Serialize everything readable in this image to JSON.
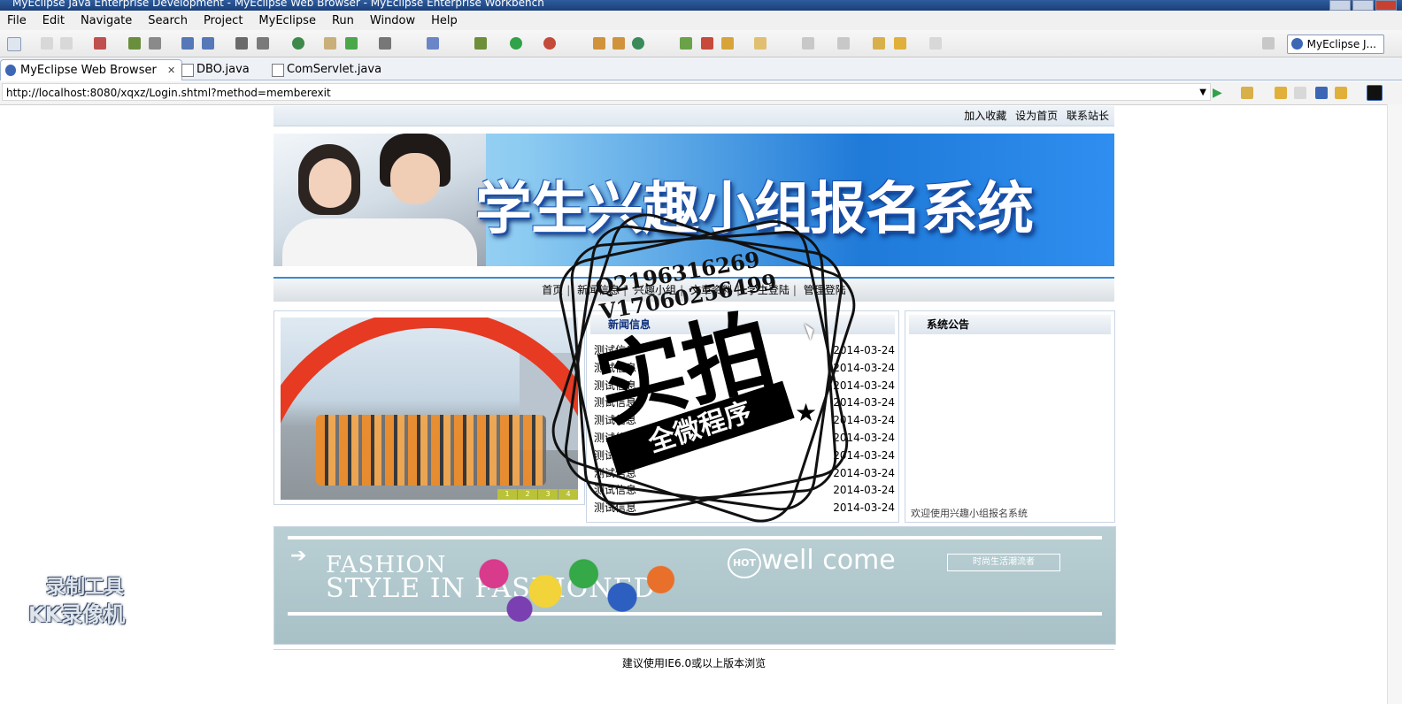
{
  "window": {
    "title": "MyEclipse Java Enterprise Development - MyEclipse Web Browser - MyEclipse Enterprise Workbench"
  },
  "menu": [
    "File",
    "Edit",
    "Navigate",
    "Search",
    "Project",
    "MyEclipse",
    "Run",
    "Window",
    "Help"
  ],
  "toolbar": {
    "perspective_label": "MyEclipse J..."
  },
  "tabs": [
    {
      "label": "MyEclipse Web Browser",
      "close": "✕"
    },
    {
      "label": "DBO.java"
    },
    {
      "label": "ComServlet.java"
    }
  ],
  "address": {
    "url": "http://localhost:8080/xqxz/Login.shtml?method=memberexit"
  },
  "site": {
    "top_links": [
      "加入收藏",
      "设为首页",
      "联系站长"
    ],
    "banner_title": "学生兴趣小组报名系统",
    "nav": [
      "首页",
      "新闻信息",
      "兴趣小组",
      "文章资料",
      "学生登陆",
      "管理登陆"
    ],
    "photo_pager": [
      "1",
      "2",
      "3",
      "4"
    ],
    "news": {
      "title": "新闻信息",
      "items": [
        {
          "title": "测试信息",
          "date": "2014-03-24"
        },
        {
          "title": "测试信息",
          "date": "2014-03-24"
        },
        {
          "title": "测试信息",
          "date": "2014-03-24"
        },
        {
          "title": "测试信息",
          "date": "2014-03-24"
        },
        {
          "title": "测试信息",
          "date": "2014-03-24"
        },
        {
          "title": "测试信息",
          "date": "2014-03-24"
        },
        {
          "title": "测试信息",
          "date": "2014-03-24"
        },
        {
          "title": "测试信息",
          "date": "2014-03-24"
        },
        {
          "title": "测试信息",
          "date": "2014-03-24"
        },
        {
          "title": "测试信息",
          "date": "2014-03-24"
        }
      ]
    },
    "notice": {
      "title": "系统公告",
      "scroll_text": "欢迎使用兴趣小组报名系统"
    },
    "fashion": {
      "line1": "FASHION",
      "line2": "STYLE IN FASHIONED",
      "hot": "HOT",
      "welcome": "well come",
      "button": "时尚生活潮流者"
    },
    "footer": "建议使用IE6.0或以上版本浏览"
  },
  "overlay": {
    "qq": "Q2196316269",
    "vx": "V17060256499",
    "stamp_big": "实拍",
    "stamp_ribbon": "全微程序",
    "recorder_line1": "录制工具",
    "recorder_line2": "KK录像机"
  }
}
